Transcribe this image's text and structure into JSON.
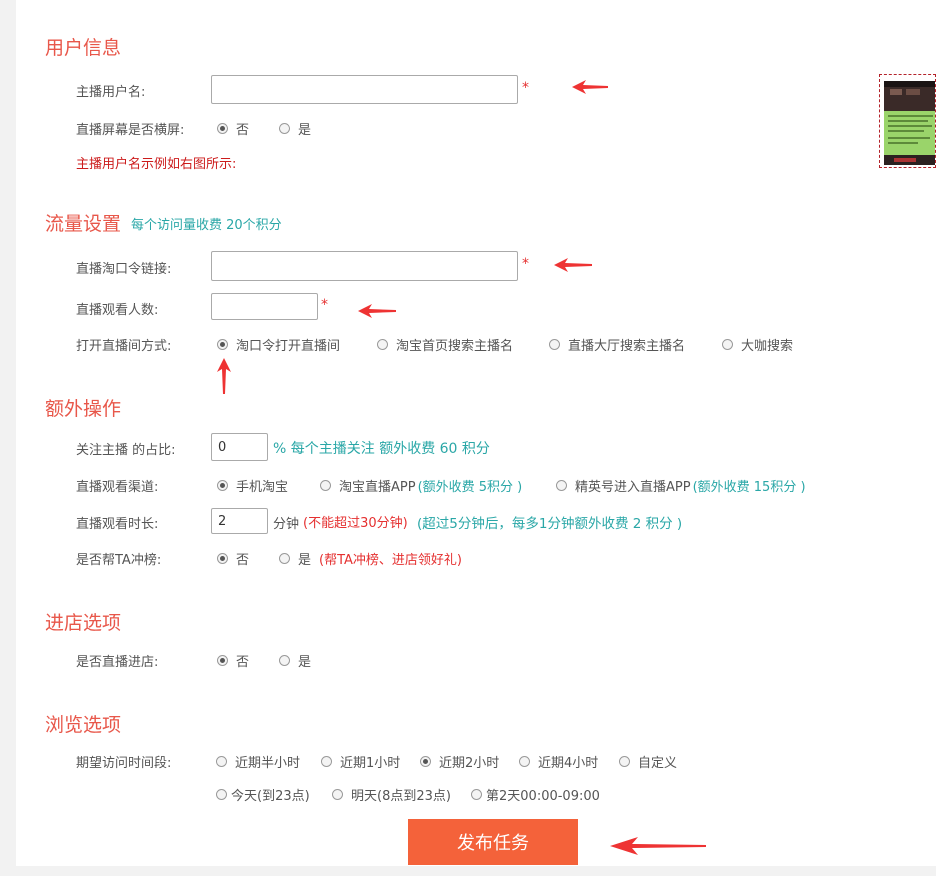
{
  "user_info": {
    "title": "用户信息",
    "username_label": "主播用户名:",
    "username_value": "",
    "required_mark": "*",
    "landscape_label": "直播屏幕是否横屏:",
    "landscape_options": [
      "否",
      "是"
    ],
    "landscape_selected": 0,
    "example_note": "主播用户名示例如右图所示:"
  },
  "traffic": {
    "title": "流量设置",
    "note": "每个访问量收费 20个积分",
    "link_label": "直播淘口令链接:",
    "link_value": "",
    "viewers_label": "直播观看人数:",
    "viewers_value": "",
    "required_mark": "*",
    "open_label": "打开直播间方式:",
    "open_options": [
      "淘口令打开直播间",
      "淘宝首页搜索主播名",
      "直播大厅搜索主播名",
      "大咖搜索"
    ],
    "open_selected": 0
  },
  "extra": {
    "title": "额外操作",
    "follow_label": "关注主播 的占比:",
    "follow_value": "0",
    "follow_note": "% 每个主播关注 额外收费 60 积分",
    "channel_label": "直播观看渠道:",
    "channel_options": [
      {
        "label": "手机淘宝",
        "note": ""
      },
      {
        "label": "淘宝直播APP",
        "note": "(额外收费 5积分 )"
      },
      {
        "label": "精英号进入直播APP",
        "note": "(额外收费 15积分 )"
      }
    ],
    "channel_selected": 0,
    "duration_label": "直播观看时长:",
    "duration_value": "2",
    "duration_unit": "分钟",
    "duration_limit": "(不能超过30分钟)",
    "duration_note": "(超过5分钟后，每多1分钟额外收费 2 积分 )",
    "rank_label": "是否帮TA冲榜:",
    "rank_options": [
      "否",
      "是"
    ],
    "rank_selected": 0,
    "rank_note": "(帮TA冲榜、进店领好礼)"
  },
  "store": {
    "title": "进店选项",
    "enter_label": "是否直播进店:",
    "enter_options": [
      "否",
      "是"
    ],
    "enter_selected": 0
  },
  "browse": {
    "title": "浏览选项",
    "period_label": "期望访问时间段:",
    "period_options_row1": [
      "近期半小时",
      "近期1小时",
      "近期2小时",
      "近期4小时",
      "自定义"
    ],
    "period_options_row2": [
      "今天(到23点)",
      "明天(8点到23点)",
      "第2天00:00-09:00"
    ],
    "period_selected": "近期2小时"
  },
  "submit_label": "发布任务",
  "colors": {
    "section_title": "#e8574a",
    "note_teal": "#2aa7a7",
    "warning_red": "#e53030",
    "submit_bg": "#f4623a",
    "arrow": "#ee3333"
  }
}
